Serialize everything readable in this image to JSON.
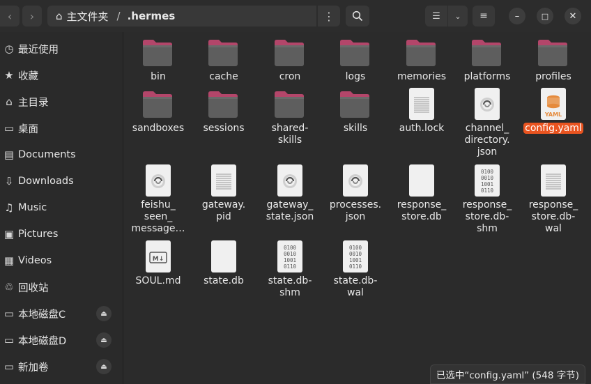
{
  "path": {
    "home": "主文件夹",
    "separator": "/",
    "current": ".hermes"
  },
  "sidebar": {
    "items": [
      {
        "icon": "clock-icon",
        "glyph": "◷",
        "label": "最近使用"
      },
      {
        "icon": "star-icon",
        "glyph": "★",
        "label": "收藏"
      },
      {
        "icon": "home-icon",
        "glyph": "⌂",
        "label": "主目录"
      },
      {
        "icon": "desktop-icon",
        "glyph": "▭",
        "label": "桌面"
      },
      {
        "icon": "document-icon",
        "glyph": "▤",
        "label": "Documents"
      },
      {
        "icon": "download-icon",
        "glyph": "⇩",
        "label": "Downloads"
      },
      {
        "icon": "music-icon",
        "glyph": "♫",
        "label": "Music"
      },
      {
        "icon": "picture-icon",
        "glyph": "▣",
        "label": "Pictures"
      },
      {
        "icon": "video-icon",
        "glyph": "▦",
        "label": "Videos"
      },
      {
        "icon": "trash-icon",
        "glyph": "♲",
        "label": "回收站"
      },
      {
        "icon": "drive-icon",
        "glyph": "▭",
        "label": "本地磁盘C"
      },
      {
        "icon": "drive-icon",
        "glyph": "▭",
        "label": "本地磁盘D"
      },
      {
        "icon": "drive-icon",
        "glyph": "▭",
        "label": "新加卷"
      }
    ]
  },
  "files": [
    {
      "name": "bin",
      "type": "folder"
    },
    {
      "name": "cache",
      "type": "folder"
    },
    {
      "name": "cron",
      "type": "folder"
    },
    {
      "name": "logs",
      "type": "folder"
    },
    {
      "name": "memories",
      "type": "folder"
    },
    {
      "name": "platforms",
      "type": "folder"
    },
    {
      "name": "profiles",
      "type": "folder"
    },
    {
      "name": "sandboxes",
      "type": "folder"
    },
    {
      "name": "sessions",
      "type": "folder"
    },
    {
      "name": "shared-\nskills",
      "type": "folder"
    },
    {
      "name": "skills",
      "type": "folder"
    },
    {
      "name": "auth.lock",
      "type": "text"
    },
    {
      "name": "channel_\ndirectory.\njson",
      "type": "json"
    },
    {
      "name": "config.yaml",
      "type": "yaml",
      "selected": true
    },
    {
      "name": "feishu_\nseen_\nmessage…",
      "type": "json"
    },
    {
      "name": "gateway.\npid",
      "type": "text"
    },
    {
      "name": "gateway_\nstate.json",
      "type": "json"
    },
    {
      "name": "processes.\njson",
      "type": "json"
    },
    {
      "name": "response_\nstore.db",
      "type": "blank"
    },
    {
      "name": "response_\nstore.db-\nshm",
      "type": "binary"
    },
    {
      "name": "response_\nstore.db-\nwal",
      "type": "text"
    },
    {
      "name": "SOUL.md",
      "type": "markdown"
    },
    {
      "name": "state.db",
      "type": "blank"
    },
    {
      "name": "state.db-\nshm",
      "type": "binary"
    },
    {
      "name": "state.db-\nwal",
      "type": "binary"
    }
  ],
  "binary_lines": [
    "0100",
    "0010",
    "1001",
    "0110"
  ],
  "yaml_label": "YAML",
  "md_label": "M↓",
  "status": "已选中“config.yaml” (548 字节)",
  "colors": {
    "accent": "#e95420",
    "folder_tab": "#b3466a",
    "folder_body": "#5e5e5e"
  }
}
